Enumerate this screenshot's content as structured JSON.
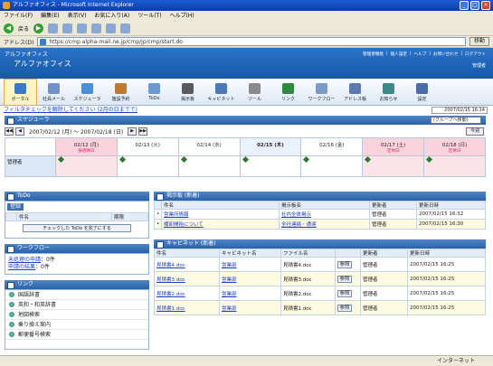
{
  "window": {
    "title": "アルファオフィス - Microsoft Internet Explorer"
  },
  "menu": [
    "ファイル(F)",
    "編集(E)",
    "表示(V)",
    "お気に入り(A)",
    "ツール(T)",
    "ヘルプ(H)"
  ],
  "toolbar": {
    "back": "戻る"
  },
  "address": {
    "label": "アドレス(D)",
    "url": "https://cmp.alpha-mail.ne.jp/cmp/jp/cmp/start.do",
    "go": "移動"
  },
  "header": {
    "app_small": "アルファオフィス",
    "app_title": "アルファオフィス",
    "links": [
      "管理者機能",
      "個人設定",
      "ヘルプ",
      "お問い合わせ",
      "ログアウト"
    ],
    "user": "管理者"
  },
  "apps": [
    {
      "label": "ポータル",
      "icon": "portal-icon",
      "color": "#3a78c8"
    },
    {
      "label": "社員メール",
      "icon": "mail-icon",
      "color": "#6d93c8"
    },
    {
      "label": "スケジューラ",
      "icon": "scheduler-icon",
      "color": "#4a8fd8"
    },
    {
      "label": "施設予約",
      "icon": "facility-icon",
      "color": "#c07a2a"
    },
    {
      "label": "ToDo",
      "icon": "todo-icon",
      "color": "#6a9ad0"
    },
    {
      "label": "掲示板",
      "icon": "board-icon",
      "color": "#5a5a5a"
    },
    {
      "label": "キャビネット",
      "icon": "cabinet-icon",
      "color": "#4a78b8"
    },
    {
      "label": "ツール",
      "icon": "tool-icon",
      "color": "#8a8a8a"
    },
    {
      "label": "リンク",
      "icon": "link-icon",
      "color": "#2e8a3e"
    },
    {
      "label": "ワークフロー",
      "icon": "workflow-icon",
      "color": "#7a9ac8"
    },
    {
      "label": "アドレス帳",
      "icon": "addressbook-icon",
      "color": "#5a7ab0"
    },
    {
      "label": "お知らせ",
      "icon": "notice-icon",
      "color": "#3a8a8a"
    },
    {
      "label": "設定",
      "icon": "settings-icon",
      "color": "#4a6aa8"
    }
  ],
  "filter": {
    "link": "フィルタチェックを解除してください (2月の日までで)",
    "datetime": "2007/02/15 16:14"
  },
  "scheduler": {
    "title": "スケジューラ",
    "group": "(グループへ移動)",
    "range": "2007/02/12 (月) ～ 2007/02/18 (日)",
    "today_button": "今週",
    "days": [
      {
        "date": "02/12 (月)",
        "note": "振替休日",
        "kind": "sat"
      },
      {
        "date": "02/13 (火)",
        "note": "",
        "kind": ""
      },
      {
        "date": "02/14 (水)",
        "note": "",
        "kind": ""
      },
      {
        "date": "02/15 (木)",
        "note": "",
        "kind": "today"
      },
      {
        "date": "02/16 (金)",
        "note": "",
        "kind": ""
      },
      {
        "date": "02/17 (土)",
        "note": "定休日",
        "kind": "sat"
      },
      {
        "date": "02/18 (日)",
        "note": "定休日",
        "kind": "sun"
      }
    ],
    "user": "管理者"
  },
  "todo": {
    "title": "ToDo",
    "register": "登録",
    "col_name": "件名",
    "col_due": "期限",
    "done_button": "チェックした ToDo を完了にする"
  },
  "workflow": {
    "title": "ワークフロー",
    "line1_link": "未処理の申請",
    "line1_count": "：0件",
    "line2_link": "申請の結果",
    "line2_count": "：0件"
  },
  "links": {
    "title": "リンク",
    "items": [
      "国語辞書",
      "英和・和英辞書",
      "地図検索",
      "乗り換え案内",
      "郵便番号検索"
    ]
  },
  "board": {
    "title": "掲示板 (新着)",
    "cols": [
      "件名",
      "掲示板名",
      "更新者",
      "更新日時"
    ],
    "rows": [
      {
        "subject": "営業所情報",
        "board": "社内全体掲示",
        "by": "管理者",
        "at": "2007/02/15 16:32"
      },
      {
        "subject": "棚卸開始について",
        "board": "全社連絡・通達",
        "by": "管理者",
        "at": "2007/02/15 16:30"
      }
    ]
  },
  "cabinet": {
    "title": "キャビネット (新着)",
    "cols": [
      "件名",
      "キャビネット名",
      "ファイル名",
      "",
      "更新者",
      "更新日時"
    ],
    "rows": [
      {
        "subject": "見積書4.doc",
        "cabinet": "営業部",
        "file": "見積書4.doc",
        "btn": "参照",
        "by": "管理者",
        "at": "2007/02/15 16:25"
      },
      {
        "subject": "見積書3.doc",
        "cabinet": "営業部",
        "file": "見積書3.doc",
        "btn": "参照",
        "by": "管理者",
        "at": "2007/02/15 16:25"
      },
      {
        "subject": "見積書2.doc",
        "cabinet": "営業部",
        "file": "見積書2.doc",
        "btn": "参照",
        "by": "管理者",
        "at": "2007/02/15 16:25"
      },
      {
        "subject": "見積書1.doc",
        "cabinet": "営業部",
        "file": "見積書1.doc",
        "btn": "参照",
        "by": "管理者",
        "at": "2007/02/15 16:25"
      }
    ]
  },
  "status": {
    "zone": "インターネット"
  }
}
